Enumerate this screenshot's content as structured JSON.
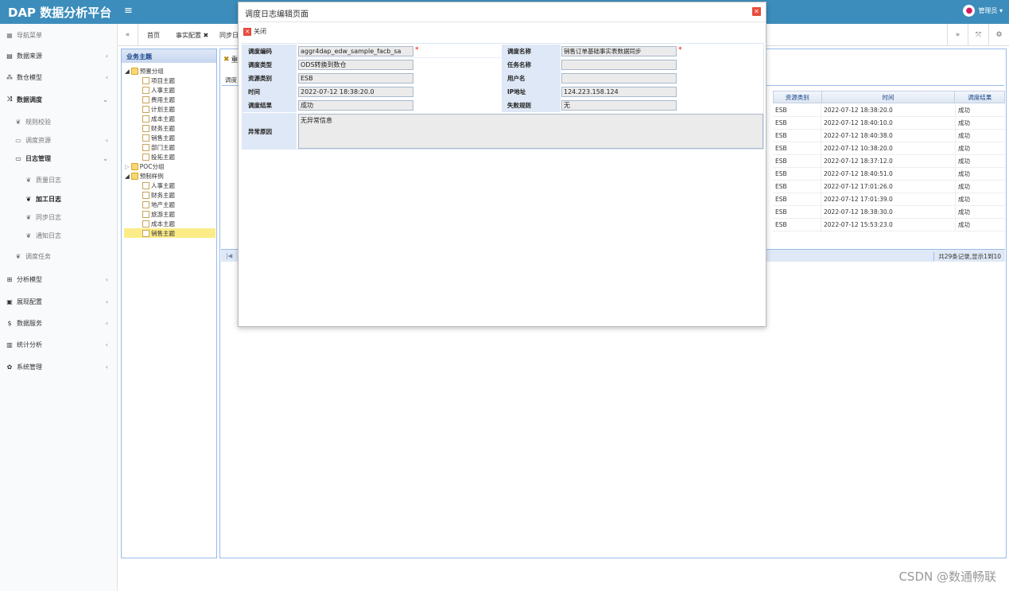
{
  "header": {
    "logo": "DAP 数据分析平台",
    "menu_toggle": "≡",
    "user": "管理员 ▾"
  },
  "sidebar": {
    "title": "导航菜单",
    "items": [
      {
        "label": "数据来源",
        "icon": "database-icon"
      },
      {
        "label": "数仓模型",
        "icon": "cubes-icon"
      },
      {
        "label": "数据调度",
        "icon": "shuffle-icon"
      },
      {
        "label": "规则校验",
        "icon": "leaf-icon"
      },
      {
        "label": "调度资源",
        "icon": "folder-icon"
      },
      {
        "label": "日志管理",
        "icon": "folder-icon"
      },
      {
        "label": "质量日志",
        "icon": "leaf-icon"
      },
      {
        "label": "加工日志",
        "icon": "leaf-icon"
      },
      {
        "label": "同步日志",
        "icon": "leaf-icon"
      },
      {
        "label": "通知日志",
        "icon": "leaf-icon"
      },
      {
        "label": "调度任务",
        "icon": "leaf-icon"
      },
      {
        "label": "分析模型",
        "icon": "sitemap-icon"
      },
      {
        "label": "展现配置",
        "icon": "film-icon"
      },
      {
        "label": "数据服务",
        "icon": "dollar-icon"
      },
      {
        "label": "统计分析",
        "icon": "bar-chart-icon"
      },
      {
        "label": "系统管理",
        "icon": "gear-icon"
      }
    ]
  },
  "tabs": [
    {
      "label": "首页"
    },
    {
      "label": "事实配置 ✖"
    },
    {
      "label": "同步日"
    }
  ],
  "biz_tree": {
    "title": "业务主题",
    "nodes": [
      "预置分组",
      "项目主题",
      "人事主题",
      "费用主题",
      "计划主题",
      "成本主题",
      "财务主题",
      "销售主题",
      "部门主题",
      "投拓主题",
      "POC分组",
      "预制样例",
      "人事主题",
      "财务主题",
      "地产主题",
      "旅游主题",
      "成本主题",
      "销售主题"
    ]
  },
  "main": {
    "panel_title": "重",
    "tab_label": "调度"
  },
  "grid": {
    "columns": [
      "资源类别",
      "时间",
      "调度结果"
    ],
    "rows": [
      [
        "ESB",
        "2022-07-12 18:38:20.0",
        "成功"
      ],
      [
        "ESB",
        "2022-07-12 18:40:10.0",
        "成功"
      ],
      [
        "ESB",
        "2022-07-12 18:40:38.0",
        "成功"
      ],
      [
        "ESB",
        "2022-07-12 10:38:20.0",
        "成功"
      ],
      [
        "ESB",
        "2022-07-12 18:37:12.0",
        "成功"
      ],
      [
        "ESB",
        "2022-07-12 18:40:51.0",
        "成功"
      ],
      [
        "ESB",
        "2022-07-12 17:01:26.0",
        "成功"
      ],
      [
        "ESB",
        "2022-07-12 17:01:39.0",
        "成功"
      ],
      [
        "ESB",
        "2022-07-12 18:38:30.0",
        "成功"
      ],
      [
        "ESB",
        "2022-07-12 15:53:23.0",
        "成功"
      ]
    ],
    "pager_text": "共29条记录,显示1到10"
  },
  "dialog": {
    "title": "调度日志编辑页面",
    "close_label": "关闭",
    "fields": {
      "code_label": "调度编码",
      "code_value": "aggr4dap_edw_sample_facb_sa",
      "name_label": "调度名称",
      "name_value": "销售订单基础事实表数据同步",
      "type_label": "调度类型",
      "type_value": "ODS转换到数仓",
      "task_label": "任务名称",
      "task_value": "",
      "res_label": "资源类别",
      "res_value": "ESB",
      "user_label": "用户名",
      "user_value": "",
      "time_label": "时间",
      "time_value": "2022-07-12 18:38:20.0",
      "ip_label": "IP地址",
      "ip_value": "124.223.158.124",
      "result_label": "调度结果",
      "result_value": "成功",
      "fail_label": "失败规则",
      "fail_value": "无",
      "error_label": "异常原因",
      "error_value": "无异常信息"
    }
  },
  "watermark": "CSDN @数通畅联"
}
